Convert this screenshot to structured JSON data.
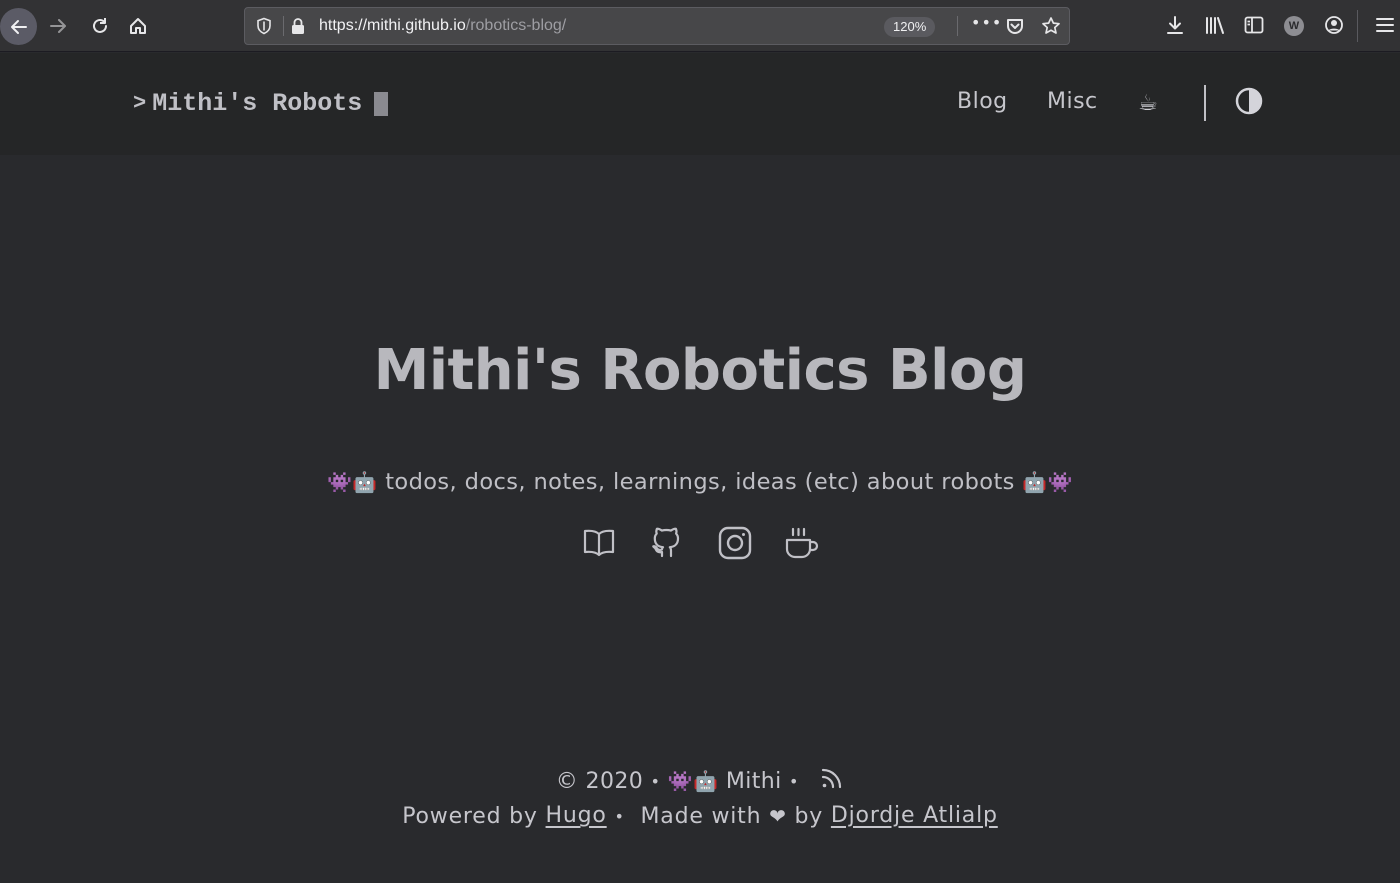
{
  "browser": {
    "url_host": "https://mithi.github.io",
    "url_path": "/robotics-blog/",
    "zoom": "120%",
    "more_label": "•••",
    "profile_initial": "W"
  },
  "site": {
    "logo_prompt": ">",
    "logo_text": "Mithi's Robots",
    "nav": {
      "blog": "Blog",
      "misc": "Misc",
      "coffee": "☕"
    }
  },
  "hero": {
    "title": "Mithi's Robotics Blog",
    "subtitle_lead_emoji": "👾🤖",
    "subtitle": "todos, docs, notes, learnings, ideas (etc) about robots",
    "subtitle_trail_emoji": "🤖👾",
    "social_icons": [
      "book-icon",
      "github-icon",
      "instagram-icon",
      "coffee-cup-icon"
    ]
  },
  "footer": {
    "copyright": "© 2020",
    "bullet": "•",
    "author_emoji": "👾🤖",
    "author": "Mithi",
    "powered_by": "Powered by",
    "hugo": "Hugo",
    "made_with": "Made with",
    "heart": "❤",
    "by": "by",
    "theme_author": "Djordje Atlialp"
  }
}
